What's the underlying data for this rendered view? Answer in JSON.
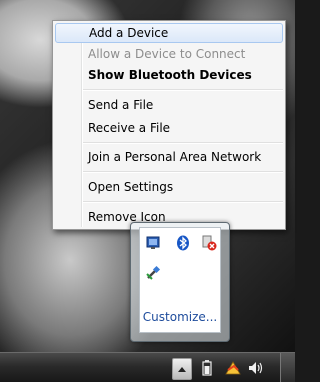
{
  "context_menu": {
    "items": [
      {
        "label": "Add a Device",
        "state": "hover"
      },
      {
        "label": "Allow a Device to Connect",
        "state": "disabled"
      },
      {
        "label": "Show Bluetooth Devices",
        "state": "bold"
      },
      {
        "label": "Send a File",
        "state": "normal"
      },
      {
        "label": "Receive a File",
        "state": "normal"
      },
      {
        "label": "Join a Personal Area Network",
        "state": "normal"
      },
      {
        "label": "Open Settings",
        "state": "normal"
      },
      {
        "label": "Remove Icon",
        "state": "normal"
      }
    ]
  },
  "tray_flyout": {
    "icons": [
      "network-icon",
      "bluetooth-icon",
      "device-error-icon",
      "usb-device-icon"
    ],
    "customize_label": "Customize..."
  },
  "taskbar": {
    "icons": [
      "up-arrow-icon",
      "battery-icon",
      "action-center-icon",
      "volume-icon"
    ]
  },
  "colors": {
    "menu_background": "#f5f5f5",
    "hover_highlight": "#dbe8f9",
    "link": "#1e4c9c",
    "taskbar": "#2a2a2a"
  }
}
